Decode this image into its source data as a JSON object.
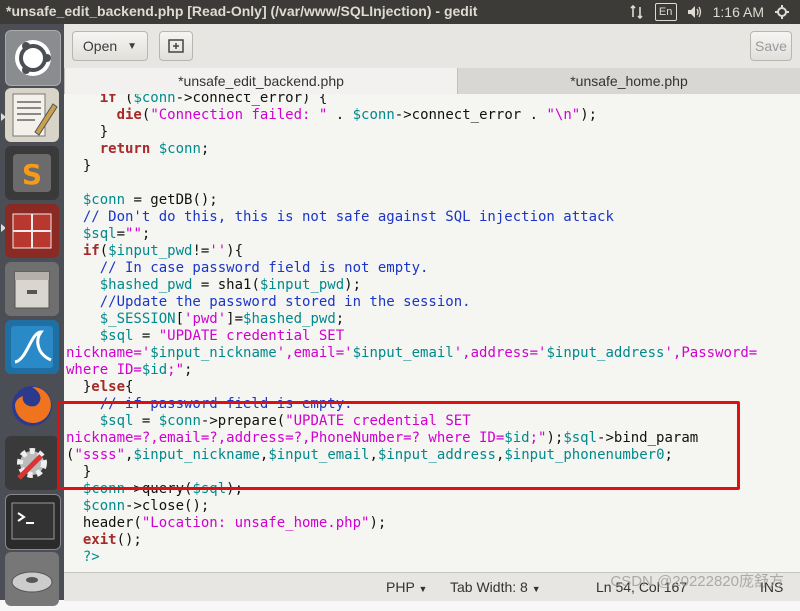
{
  "window": {
    "title": "*unsafe_edit_backend.php [Read-Only] (/var/www/SQLInjection) - gedit"
  },
  "tray": {
    "keyboard": "En",
    "clock": "1:16 AM"
  },
  "launcher": {
    "items": [
      "ubuntu-dash",
      "text-editor",
      "sublime-text",
      "workspace-switcher",
      "file-manager",
      "wireshark",
      "firefox",
      "system-settings",
      "terminal",
      "disk"
    ]
  },
  "toolbar": {
    "open_label": "Open",
    "save_label": "Save"
  },
  "tabs": [
    {
      "label": "*unsafe_edit_backend.php"
    },
    {
      "label": "*unsafe_home.php"
    }
  ],
  "code": {
    "lines": [
      [
        {
          "t": "    ",
          "c": "plain"
        },
        {
          "t": "if",
          "c": "kw"
        },
        {
          "t": " (",
          "c": "plain"
        },
        {
          "t": "$conn",
          "c": "var"
        },
        {
          "t": "->connect_error) {",
          "c": "plain"
        }
      ],
      [
        {
          "t": "      ",
          "c": "plain"
        },
        {
          "t": "die",
          "c": "kw"
        },
        {
          "t": "(",
          "c": "plain"
        },
        {
          "t": "\"Connection failed: \"",
          "c": "str"
        },
        {
          "t": " . ",
          "c": "plain"
        },
        {
          "t": "$conn",
          "c": "var"
        },
        {
          "t": "->connect_error . ",
          "c": "plain"
        },
        {
          "t": "\"\\n\"",
          "c": "str"
        },
        {
          "t": ");",
          "c": "plain"
        }
      ],
      [
        {
          "t": "    }",
          "c": "plain"
        }
      ],
      [
        {
          "t": "    ",
          "c": "plain"
        },
        {
          "t": "return",
          "c": "kw"
        },
        {
          "t": " ",
          "c": "plain"
        },
        {
          "t": "$conn",
          "c": "var"
        },
        {
          "t": ";",
          "c": "plain"
        }
      ],
      [
        {
          "t": "  }",
          "c": "plain"
        }
      ],
      [
        {
          "t": "",
          "c": "plain"
        }
      ],
      [
        {
          "t": "  ",
          "c": "plain"
        },
        {
          "t": "$conn",
          "c": "var"
        },
        {
          "t": " = getDB();",
          "c": "plain"
        }
      ],
      [
        {
          "t": "  // Don't do this, this is not safe against SQL injection attack",
          "c": "com"
        }
      ],
      [
        {
          "t": "  ",
          "c": "plain"
        },
        {
          "t": "$sql",
          "c": "var"
        },
        {
          "t": "=",
          "c": "plain"
        },
        {
          "t": "\"\"",
          "c": "str"
        },
        {
          "t": ";",
          "c": "plain"
        }
      ],
      [
        {
          "t": "  ",
          "c": "plain"
        },
        {
          "t": "if",
          "c": "kw"
        },
        {
          "t": "(",
          "c": "plain"
        },
        {
          "t": "$input_pwd",
          "c": "var"
        },
        {
          "t": "!=",
          "c": "plain"
        },
        {
          "t": "''",
          "c": "str"
        },
        {
          "t": "){",
          "c": "plain"
        }
      ],
      [
        {
          "t": "    // In case password field is not empty.",
          "c": "com"
        }
      ],
      [
        {
          "t": "    ",
          "c": "plain"
        },
        {
          "t": "$hashed_pwd",
          "c": "var"
        },
        {
          "t": " = sha1(",
          "c": "plain"
        },
        {
          "t": "$input_pwd",
          "c": "var"
        },
        {
          "t": ");",
          "c": "plain"
        }
      ],
      [
        {
          "t": "    //Update the password stored in the session.",
          "c": "com"
        }
      ],
      [
        {
          "t": "    ",
          "c": "plain"
        },
        {
          "t": "$_SESSION",
          "c": "var"
        },
        {
          "t": "[",
          "c": "plain"
        },
        {
          "t": "'pwd'",
          "c": "str"
        },
        {
          "t": "]=",
          "c": "plain"
        },
        {
          "t": "$hashed_pwd",
          "c": "var"
        },
        {
          "t": ";",
          "c": "plain"
        }
      ],
      [
        {
          "t": "    ",
          "c": "plain"
        },
        {
          "t": "$sql",
          "c": "var"
        },
        {
          "t": " = ",
          "c": "plain"
        },
        {
          "t": "\"UPDATE credential SET",
          "c": "str"
        }
      ],
      [
        {
          "t": "nickname='",
          "c": "str"
        },
        {
          "t": "$input_nickname",
          "c": "var"
        },
        {
          "t": "',email='",
          "c": "str"
        },
        {
          "t": "$input_email",
          "c": "var"
        },
        {
          "t": "',address='",
          "c": "str"
        },
        {
          "t": "$input_address",
          "c": "var"
        },
        {
          "t": "',Password=",
          "c": "str"
        }
      ],
      [
        {
          "t": "where ID=",
          "c": "str"
        },
        {
          "t": "$id",
          "c": "var"
        },
        {
          "t": ";\"",
          "c": "str"
        },
        {
          "t": ";",
          "c": "plain"
        }
      ],
      [
        {
          "t": "  }",
          "c": "plain"
        },
        {
          "t": "else",
          "c": "kw"
        },
        {
          "t": "{",
          "c": "plain"
        }
      ],
      [
        {
          "t": "    // if password field is empty.",
          "c": "com"
        }
      ],
      [
        {
          "t": "    ",
          "c": "plain"
        },
        {
          "t": "$sql",
          "c": "var"
        },
        {
          "t": " = ",
          "c": "plain"
        },
        {
          "t": "$conn",
          "c": "var"
        },
        {
          "t": "->prepare(",
          "c": "plain"
        },
        {
          "t": "\"UPDATE credential SET",
          "c": "str"
        }
      ],
      [
        {
          "t": "nickname=?,email=?,address=?,PhoneNumber=? where ID=",
          "c": "str"
        },
        {
          "t": "$id",
          "c": "var"
        },
        {
          "t": ";\"",
          "c": "str"
        },
        {
          "t": ");",
          "c": "plain"
        },
        {
          "t": "$sql",
          "c": "var"
        },
        {
          "t": "->bind_param",
          "c": "plain"
        }
      ],
      [
        {
          "t": "(",
          "c": "plain"
        },
        {
          "t": "\"ssss\"",
          "c": "str"
        },
        {
          "t": ",",
          "c": "plain"
        },
        {
          "t": "$input_nickname",
          "c": "var"
        },
        {
          "t": ",",
          "c": "plain"
        },
        {
          "t": "$input_email",
          "c": "var"
        },
        {
          "t": ",",
          "c": "plain"
        },
        {
          "t": "$input_address",
          "c": "var"
        },
        {
          "t": ",",
          "c": "plain"
        },
        {
          "t": "$input_phonenumber0",
          "c": "var"
        },
        {
          "t": ";",
          "c": "plain"
        }
      ],
      [
        {
          "t": "  }",
          "c": "plain"
        }
      ],
      [
        {
          "t": "  ",
          "c": "plain"
        },
        {
          "t": "$conn",
          "c": "var"
        },
        {
          "t": "->query(",
          "c": "plain"
        },
        {
          "t": "$sql",
          "c": "var"
        },
        {
          "t": ");",
          "c": "plain"
        }
      ],
      [
        {
          "t": "  ",
          "c": "plain"
        },
        {
          "t": "$conn",
          "c": "var"
        },
        {
          "t": "->close();",
          "c": "plain"
        }
      ],
      [
        {
          "t": "  header(",
          "c": "plain"
        },
        {
          "t": "\"Location: unsafe_home.php\"",
          "c": "str"
        },
        {
          "t": ");",
          "c": "plain"
        }
      ],
      [
        {
          "t": "  ",
          "c": "plain"
        },
        {
          "t": "exit",
          "c": "kw"
        },
        {
          "t": "();",
          "c": "plain"
        }
      ],
      [
        {
          "t": "  ?>",
          "c": "var"
        }
      ]
    ]
  },
  "statusbar": {
    "language": "PHP",
    "tab_width": "Tab Width: 8",
    "position": "Ln 54, Col 167",
    "mode": "INS"
  },
  "watermark": "CSDN @20222820庞舒方",
  "colors": {
    "topbar": "#3c3b37",
    "launcher": "#4b4f55",
    "keyword": "#a52a2a",
    "variable": "#008a8c",
    "string": "#d100d1",
    "comment": "#1b36c7",
    "highlight_box": "#e01010"
  }
}
